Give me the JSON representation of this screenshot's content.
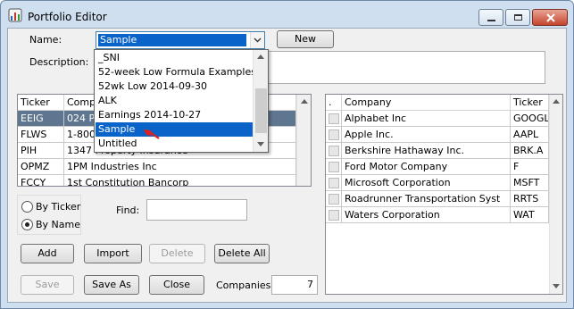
{
  "window": {
    "title": "Portfolio Editor"
  },
  "form": {
    "name_label": "Name:",
    "name_value": "Sample",
    "new_label": "New",
    "description_label": "Description:",
    "description_value": ""
  },
  "dropdown": {
    "items": [
      "_SNI",
      "52-week Low Formula Examples",
      "52wk Low 2014-09-30",
      "ALK",
      "Earnings 2014-10-27",
      "Sample",
      "Untitled"
    ],
    "selected": "Sample"
  },
  "left_grid": {
    "headers": [
      "Ticker",
      "Company"
    ],
    "rows": [
      [
        "EEIG",
        "024 Pharma Inc"
      ],
      [
        "FLWS",
        "1-800-Flowers.com Inc"
      ],
      [
        "PIH",
        "1347 Property Insurance"
      ],
      [
        "OPMZ",
        "1PM Industries Inc"
      ],
      [
        "FCCY",
        "1st Constitution Bancorp"
      ]
    ]
  },
  "sort": {
    "by_ticker": "By Ticker",
    "by_name": "By Name",
    "selected": "By Name"
  },
  "find": {
    "label": "Find:",
    "value": ""
  },
  "buttons": {
    "add": "Add",
    "import": "Import",
    "delete": "Delete",
    "delete_all": "Delete All",
    "save": "Save",
    "save_as": "Save As",
    "close": "Close"
  },
  "companies": {
    "label": "Companies:",
    "count": "7"
  },
  "right_grid": {
    "headers": [
      ".",
      "Company",
      "Ticker"
    ],
    "rows": [
      [
        "Alphabet Inc",
        "GOOGL"
      ],
      [
        "Apple Inc.",
        "AAPL"
      ],
      [
        "Berkshire Hathaway Inc.",
        "BRK.A"
      ],
      [
        "Ford Motor Company",
        "F"
      ],
      [
        "Microsoft Corporation",
        "MSFT"
      ],
      [
        "Roadrunner Transportation Syst",
        "RRTS"
      ],
      [
        "Waters Corporation",
        "WAT"
      ]
    ]
  },
  "colors": {
    "window_frame": "#cfdff0",
    "client": "#f0f0f0",
    "selection": "#0a63c8",
    "grid_selection": "#5f7690",
    "pointer_arrow": "#e02020"
  },
  "icons": {
    "app": "portfolio-app-icon",
    "minimize": "minimize-icon",
    "maximize": "maximize-icon",
    "close": "close-icon",
    "combo_arrow": "chevron-down-icon",
    "pointer": "red-arrow-icon"
  }
}
